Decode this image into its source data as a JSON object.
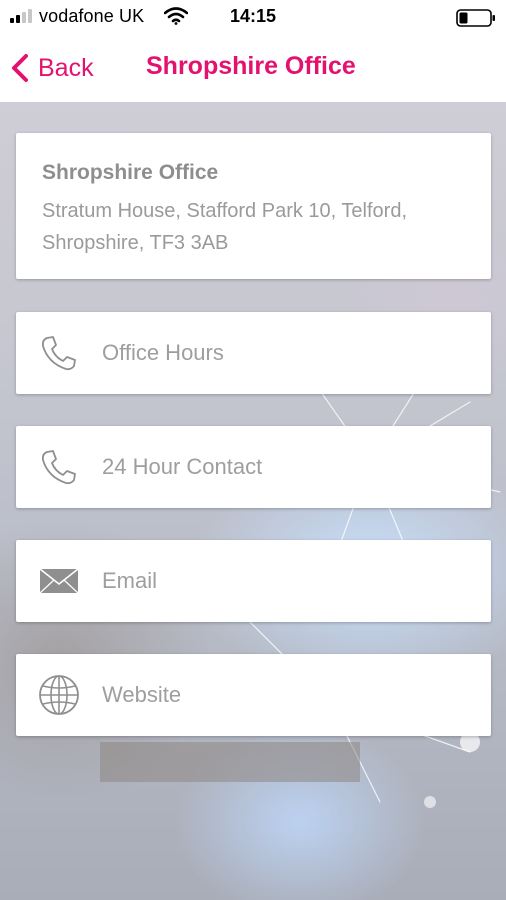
{
  "status_bar": {
    "carrier": "vodafone UK",
    "time": "14:15"
  },
  "nav": {
    "back_label": "Back",
    "title": "Shropshire Office"
  },
  "office": {
    "name": "Shropshire Office",
    "address": "Stratum House, Stafford Park 10, Telford, Shropshire, TF3 3AB"
  },
  "actions": [
    {
      "label": "Office Hours",
      "icon": "phone-icon"
    },
    {
      "label": "24 Hour Contact",
      "icon": "phone-icon"
    },
    {
      "label": "Email",
      "icon": "envelope-icon"
    },
    {
      "label": "Website",
      "icon": "globe-icon"
    }
  ],
  "colors": {
    "accent": "#e4126f",
    "card_text": "#9e9e9e"
  }
}
